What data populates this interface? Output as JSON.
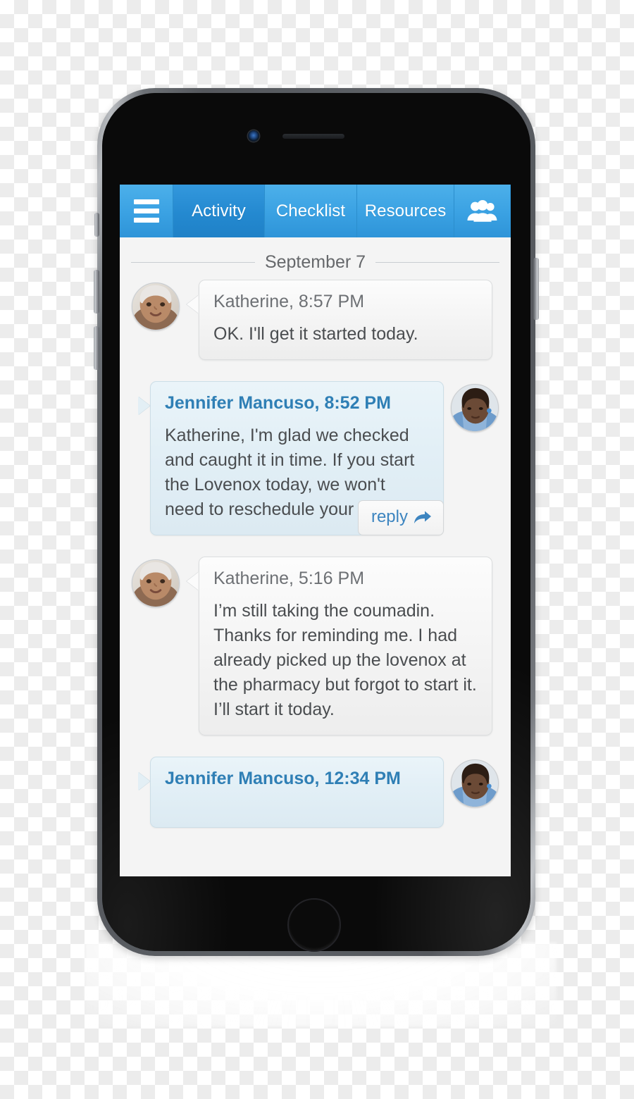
{
  "app": {
    "navbar": {
      "menu_icon": "hamburger-menu-icon",
      "people_icon": "people-group-icon",
      "tabs": [
        {
          "label": "Activity",
          "active": true
        },
        {
          "label": "Checklist",
          "active": false
        },
        {
          "label": "Resources",
          "active": false
        }
      ],
      "active_color": "#2489d0",
      "base_color": "#3ba2e3"
    },
    "chat": {
      "date_divider": "September 7",
      "messages": [
        {
          "id": "msg-katherine-857",
          "side": "left",
          "author": "Katherine",
          "time": "8:57 PM",
          "header": "Katherine, 8:57 PM",
          "body": "OK. I'll get it started today.",
          "avatar": "elderly-woman-avatar",
          "bubble_style": "grey",
          "has_reply": false
        },
        {
          "id": "msg-jennifer-852",
          "side": "right",
          "author": "Jennifer Mancuso",
          "time": "8:52 PM",
          "header": "Jennifer Mancuso, 8:52 PM",
          "body": "Katherine, I'm glad we checked and caught it in time. If you start the Lovenox today, we won't need to reschedule your surgery.",
          "avatar": "nurse-avatar",
          "bubble_style": "blue",
          "has_reply": true,
          "reply_label": "reply"
        },
        {
          "id": "msg-katherine-516",
          "side": "left",
          "author": "Katherine",
          "time": "5:16 PM",
          "header": "Katherine, 5:16 PM",
          "body": "I’m still taking the coumadin. Thanks for reminding me. I had already picked up the lovenox at the pharmacy but forgot to start it. I’ll start it today.",
          "avatar": "elderly-woman-avatar",
          "bubble_style": "grey",
          "has_reply": false
        },
        {
          "id": "msg-jennifer-1234",
          "side": "right",
          "author": "Jennifer Mancuso",
          "time": "12:34 PM",
          "header": "Jennifer Mancuso, 12:34 PM",
          "body": "",
          "avatar": "nurse-avatar",
          "bubble_style": "blue",
          "has_reply": false,
          "clipped": true
        }
      ]
    }
  },
  "device": {
    "type": "smartphone-mockup",
    "hardware": {
      "camera": "front-camera",
      "speaker": "earpiece-speaker",
      "home_button": "home-button",
      "silent_switch": "silent-switch",
      "volume_up": "volume-up-button",
      "volume_down": "volume-down-button",
      "power": "power-button"
    }
  }
}
